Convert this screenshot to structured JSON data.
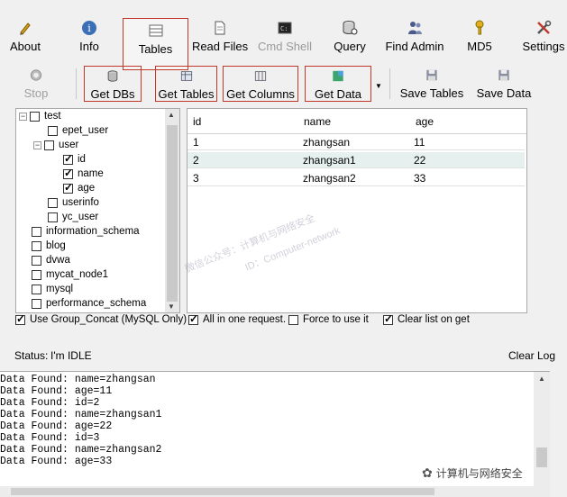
{
  "toolbar": {
    "about": "About",
    "info": "Info",
    "tables": "Tables",
    "read_files": "Read Files",
    "cmd_shell": "Cmd Shell",
    "query": "Query",
    "find_admin": "Find Admin",
    "md5": "MD5",
    "settings": "Settings"
  },
  "toolbar2": {
    "stop": "Stop",
    "get_dbs": "Get DBs",
    "get_tables": "Get Tables",
    "get_columns": "Get Columns",
    "get_data": "Get Data",
    "save_tables": "Save Tables",
    "save_data": "Save Data"
  },
  "tree": {
    "items": [
      {
        "label": "test",
        "checked": false
      },
      {
        "label": "epet_user",
        "checked": false
      },
      {
        "label": "user",
        "checked": false
      },
      {
        "label": "id",
        "checked": true
      },
      {
        "label": "name",
        "checked": true
      },
      {
        "label": "age",
        "checked": true
      },
      {
        "label": "userinfo",
        "checked": false
      },
      {
        "label": "yc_user",
        "checked": false
      },
      {
        "label": "information_schema",
        "checked": false
      },
      {
        "label": "blog",
        "checked": false
      },
      {
        "label": "dvwa",
        "checked": false
      },
      {
        "label": "mycat_node1",
        "checked": false
      },
      {
        "label": "mysql",
        "checked": false
      },
      {
        "label": "performance_schema",
        "checked": false
      }
    ]
  },
  "grid": {
    "columns": [
      "id",
      "name",
      "age"
    ],
    "rows": [
      [
        "1",
        "zhangsan",
        "11"
      ],
      [
        "2",
        "zhangsan1",
        "22"
      ],
      [
        "3",
        "zhangsan2",
        "33"
      ]
    ]
  },
  "options": {
    "group_concat": "Use Group_Concat (MySQL Only)",
    "all_in_one": "All in one request.",
    "force": "Force to use it",
    "clear_list": "Clear list on get"
  },
  "status": {
    "label": "Status:",
    "value": "I'm IDLE",
    "clear_log": "Clear Log"
  },
  "log": {
    "lines": [
      "Data Found: name=zhangsan",
      "Data Found: age=11",
      "Data Found: id=2",
      "Data Found: name=zhangsan1",
      "Data Found: age=22",
      "Data Found: id=3",
      "Data Found: name=zhangsan2",
      "Data Found: age=33"
    ]
  },
  "watermark": {
    "line1": "微信公众号：计算机与网络安全",
    "line2": "ID：Computer-network",
    "corner": "计算机与网络安全"
  },
  "colors": {
    "highlight_row": "#e6f1ef",
    "red_border": "#c0392b"
  }
}
